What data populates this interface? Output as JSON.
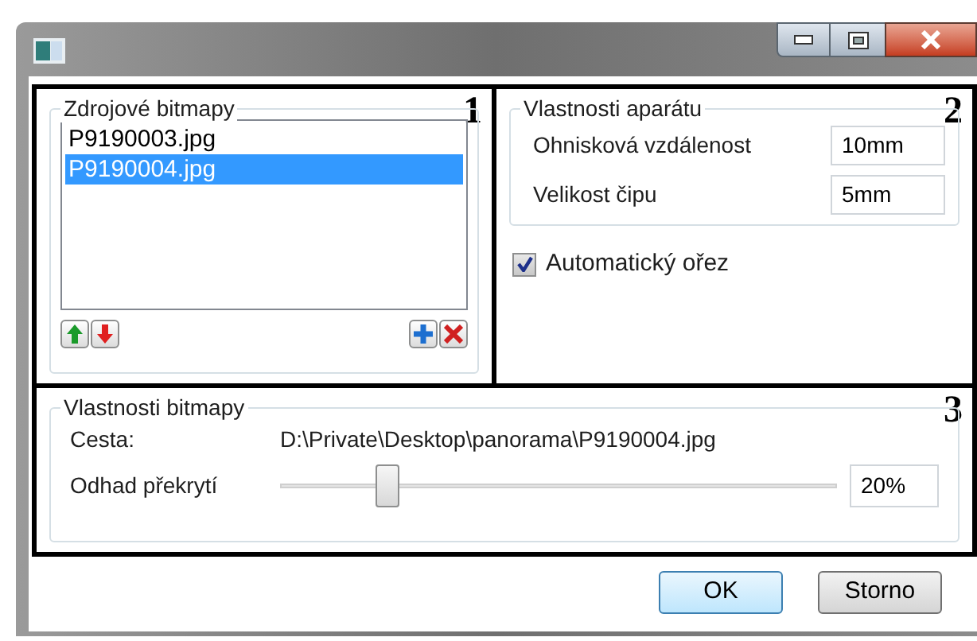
{
  "window": {
    "controls": [
      {
        "kind": "minimize"
      },
      {
        "kind": "maximize"
      },
      {
        "kind": "close"
      }
    ]
  },
  "sources": {
    "number": "1",
    "title": "Zdrojové bitmapy",
    "files": [
      {
        "name": "P9190003.jpg",
        "selected": false
      },
      {
        "name": "P9190004.jpg",
        "selected": true
      }
    ]
  },
  "camera": {
    "number": "2",
    "title": "Vlastnosti aparátu",
    "fields": [
      {
        "label": "Ohnisková vzdálenost",
        "value": "10mm"
      },
      {
        "label": "Velikost čipu",
        "value": "5mm"
      }
    ],
    "auto_crop": {
      "label": "Automatický ořez",
      "checked": true
    }
  },
  "bitmap": {
    "number": "3",
    "title": "Vlastnosti bitmapy",
    "path_label": "Cesta:",
    "path": "D:\\Private\\Desktop\\panorama\\P9190004.jpg",
    "overlap_label": "Odhad překrytí",
    "overlap": {
      "level": 0.19,
      "reading": "20%"
    }
  },
  "buttons": [
    {
      "label": "OK",
      "default": true
    },
    {
      "label": "Storno",
      "default": false
    }
  ]
}
